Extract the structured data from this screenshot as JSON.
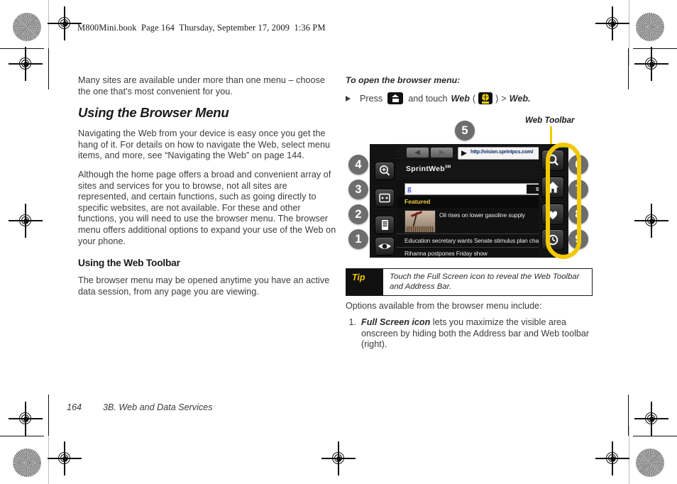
{
  "running_head": "M800Mini.book  Page 164  Thursday, September 17, 2009  1:36 PM",
  "left_column": {
    "intro_paragraph": "Many sites are available under more than one menu – choose the one that's most convenient for you.",
    "heading": "Using the Browser Menu",
    "paragraph_1": "Navigating the Web from your device is easy once you get the hang of it. For details on how to navigate the Web, select menu items, and more, see “Navigating the Web” on page 144.",
    "paragraph_2": "Although the home page offers a broad and convenient array of sites and services for you to browse, not all sites are represented, and certain functions, such as going directly to specific websites, are not available. For these and other functions, you will need to use the browser menu. The browser menu offers additional options to expand your use of the Web on your phone.",
    "subheading": "Using the Web Toolbar",
    "paragraph_3": "The browser menu may be opened anytime you have an active data session, from any page you are viewing."
  },
  "right_column": {
    "lead_in": "To open the browser menu:",
    "step": {
      "word_press": "Press",
      "word_and_touch": "and touch",
      "web_italic": "Web",
      "paren_open": "(",
      "paren_close": ")",
      "separator": ">",
      "web_end": "Web.",
      "home_icon_name": "home-icon",
      "web_icon_name": "web-globe-icon"
    },
    "figure": {
      "web_toolbar_label": "Web Toolbar",
      "callouts": [
        "1",
        "2",
        "3",
        "4",
        "5",
        "6",
        "7",
        "8",
        "9"
      ],
      "phone_screen": {
        "url": "http://vision.sprintpcs.com/",
        "reload_glyph": "↻",
        "brand": "SprintWeb",
        "brand_tm": "SM",
        "search_engine_logo": "g",
        "search_button": "Search",
        "featured_label": "Featured",
        "stories": [
          "Oil rises on lower gasoline supply",
          "Education secretary wants Senate stimulus plan changed",
          "Rihanna postpones Friday show"
        ],
        "left_toolbar_icons": [
          "zoom-in-icon",
          "window-view-icon",
          "page-view-icon",
          "eye-icon"
        ],
        "right_toolbar_icons": [
          "search-icon",
          "home-icon",
          "favorites-heart-icon",
          "history-clock-icon"
        ]
      }
    },
    "tip": {
      "label": "Tip",
      "text": "Touch the Full Screen icon to reveal the Web Toolbar and Address Bar."
    },
    "options_intro": "Options available from the browser menu include:",
    "options": [
      {
        "number": "1.",
        "emphasis": "Full Screen icon",
        "text": " lets you maximize the visible area onscreen by hiding both the Address bar and Web toolbar (right)."
      }
    ]
  },
  "footer": {
    "page_number": "164",
    "chapter": "3B. Web and Data Services"
  },
  "colors": {
    "highlight_yellow": "#f2c900",
    "tip_label_yellow": "#f2c900",
    "callout_gray": "#6d6d6d",
    "text_gray": "#3b3b3b"
  }
}
